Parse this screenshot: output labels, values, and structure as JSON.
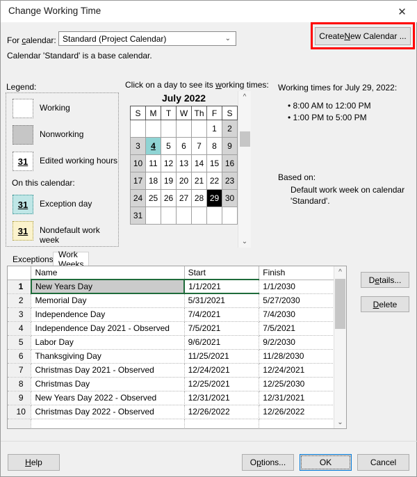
{
  "window": {
    "title": "Change Working Time",
    "close_icon": "close-icon"
  },
  "calendar_selector": {
    "label": "For calendar:",
    "label_pre": "For ",
    "label_accel": "c",
    "label_post": "alendar:",
    "value": "Standard (Project Calendar)",
    "dropdown_icon": "chevron-down-icon",
    "note": "Calendar 'Standard' is a base calendar.",
    "create_button": "Create New Calendar ...",
    "create_button_pre": "Create ",
    "create_button_accel": "N",
    "create_button_post": "ew Calendar ...",
    "highlight_color": "#ff0000"
  },
  "legend": {
    "title": "Legend:",
    "on_this_calendar": "On this calendar:",
    "day_number": "31",
    "items": [
      {
        "label": "Working",
        "swatch": "working",
        "color": "#ffffff",
        "shows_number": false
      },
      {
        "label": "Nonworking",
        "swatch": "nonworking",
        "color": "#c6c6c6",
        "shows_number": false
      },
      {
        "label": "Edited working hours",
        "swatch": "edited",
        "color": "#ffffff",
        "shows_number": true
      },
      {
        "label": "Exception day",
        "swatch": "exception",
        "color": "#bfe6e6",
        "shows_number": true
      },
      {
        "label": "Nondefault work week",
        "swatch": "nondefault",
        "color": "#fbf3cd",
        "shows_number": true
      }
    ]
  },
  "mini_calendar": {
    "hint_pre": "Click on a day to see its ",
    "hint_accel": "w",
    "hint_post": "orking times:",
    "month_title": "July 2022",
    "weekday_headers": [
      "S",
      "M",
      "T",
      "W",
      "Th",
      "F",
      "S"
    ],
    "weeks": [
      [
        {
          "d": "",
          "t": "empty"
        },
        {
          "d": "",
          "t": "empty"
        },
        {
          "d": "",
          "t": "empty"
        },
        {
          "d": "",
          "t": "empty"
        },
        {
          "d": "",
          "t": "empty"
        },
        {
          "d": "1",
          "t": "work"
        },
        {
          "d": "2",
          "t": "weekend"
        }
      ],
      [
        {
          "d": "3",
          "t": "weekend"
        },
        {
          "d": "4",
          "t": "exception"
        },
        {
          "d": "5",
          "t": "work"
        },
        {
          "d": "6",
          "t": "work"
        },
        {
          "d": "7",
          "t": "work"
        },
        {
          "d": "8",
          "t": "work"
        },
        {
          "d": "9",
          "t": "weekend"
        }
      ],
      [
        {
          "d": "10",
          "t": "weekend"
        },
        {
          "d": "11",
          "t": "work"
        },
        {
          "d": "12",
          "t": "work"
        },
        {
          "d": "13",
          "t": "work"
        },
        {
          "d": "14",
          "t": "work"
        },
        {
          "d": "15",
          "t": "work"
        },
        {
          "d": "16",
          "t": "weekend"
        }
      ],
      [
        {
          "d": "17",
          "t": "weekend"
        },
        {
          "d": "18",
          "t": "work"
        },
        {
          "d": "19",
          "t": "work"
        },
        {
          "d": "20",
          "t": "work"
        },
        {
          "d": "21",
          "t": "work"
        },
        {
          "d": "22",
          "t": "work"
        },
        {
          "d": "23",
          "t": "weekend"
        }
      ],
      [
        {
          "d": "24",
          "t": "weekend"
        },
        {
          "d": "25",
          "t": "work"
        },
        {
          "d": "26",
          "t": "work"
        },
        {
          "d": "27",
          "t": "work"
        },
        {
          "d": "28",
          "t": "work"
        },
        {
          "d": "29",
          "t": "selected"
        },
        {
          "d": "30",
          "t": "weekend"
        }
      ],
      [
        {
          "d": "31",
          "t": "weekend"
        },
        {
          "d": "",
          "t": "empty"
        },
        {
          "d": "",
          "t": "empty"
        },
        {
          "d": "",
          "t": "empty"
        },
        {
          "d": "",
          "t": "empty"
        },
        {
          "d": "",
          "t": "empty"
        },
        {
          "d": "",
          "t": "empty"
        }
      ]
    ],
    "scroll_up_icon": "chevron-up-icon",
    "scroll_down_icon": "chevron-down-icon"
  },
  "working_times": {
    "title": "Working times for July 29, 2022:",
    "entries": [
      "• 8:00 AM to 12:00 PM",
      "• 1:00 PM to 5:00 PM"
    ],
    "based_on_label": "Based on:",
    "based_on_value": "Default work week on calendar 'Standard'."
  },
  "tabs": [
    {
      "label": "Exceptions",
      "active": true
    },
    {
      "label": "Work Weeks",
      "active": false
    }
  ],
  "exceptions_table": {
    "columns": [
      "",
      "Name",
      "Start",
      "Finish"
    ],
    "rows": [
      {
        "index": "1",
        "name": "New Years Day",
        "start": "1/1/2021",
        "finish": "1/1/2030",
        "selected": true
      },
      {
        "index": "2",
        "name": "Memorial Day",
        "start": "5/31/2021",
        "finish": "5/27/2030",
        "selected": false
      },
      {
        "index": "3",
        "name": "Independence Day",
        "start": "7/4/2021",
        "finish": "7/4/2030",
        "selected": false
      },
      {
        "index": "4",
        "name": "Independence Day 2021 - Observed",
        "start": "7/5/2021",
        "finish": "7/5/2021",
        "selected": false
      },
      {
        "index": "5",
        "name": "Labor Day",
        "start": "9/6/2021",
        "finish": "9/2/2030",
        "selected": false
      },
      {
        "index": "6",
        "name": "Thanksgiving Day",
        "start": "11/25/2021",
        "finish": "11/28/2030",
        "selected": false
      },
      {
        "index": "7",
        "name": "Christmas Day 2021 - Observed",
        "start": "12/24/2021",
        "finish": "12/24/2021",
        "selected": false
      },
      {
        "index": "8",
        "name": "Christmas Day",
        "start": "12/25/2021",
        "finish": "12/25/2030",
        "selected": false
      },
      {
        "index": "9",
        "name": "New Years Day 2022 - Observed",
        "start": "12/31/2021",
        "finish": "12/31/2021",
        "selected": false
      },
      {
        "index": "10",
        "name": "Christmas Day 2022 - Observed",
        "start": "12/26/2022",
        "finish": "12/26/2022",
        "selected": false
      },
      {
        "index": "",
        "name": "",
        "start": "",
        "finish": "",
        "selected": false
      }
    ],
    "scroll_up_icon": "chevron-up-icon",
    "scroll_down_icon": "chevron-down-icon",
    "selection_border_color": "#1e6b3a"
  },
  "side_buttons": {
    "details_pre": "D",
    "details_accel": "e",
    "details_post": "tails...",
    "delete_pre": "",
    "delete_accel": "D",
    "delete_post": "elete"
  },
  "footer": {
    "help_pre": "",
    "help_accel": "H",
    "help_post": "elp",
    "options_pre": "O",
    "options_accel": "p",
    "options_post": "tions...",
    "ok": "OK",
    "cancel": "Cancel",
    "focus_color": "#0078d7"
  }
}
